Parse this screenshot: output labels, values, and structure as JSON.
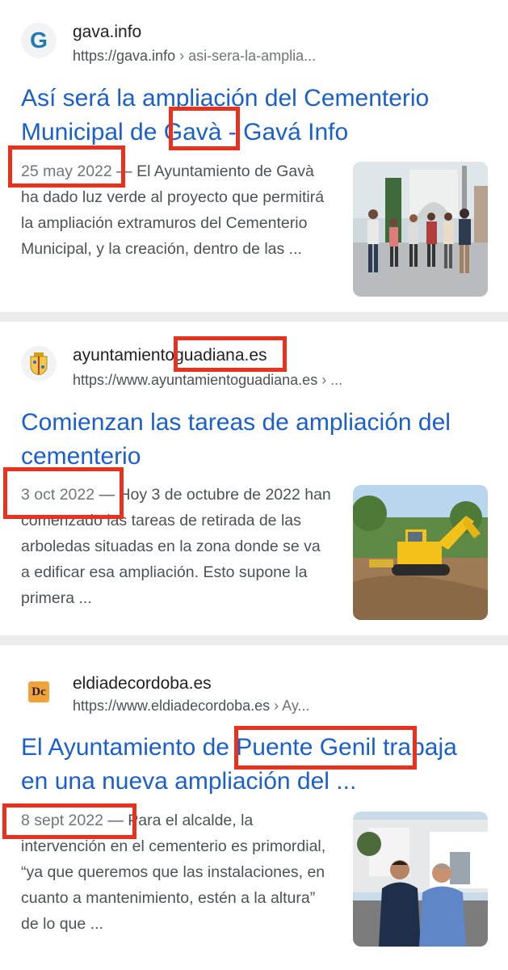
{
  "results": [
    {
      "site_name": "gava.info",
      "url_base": "https://gava.info",
      "url_path": " › asi-sera-la-amplia...",
      "favicon_icon": "gava-g-logo-icon",
      "favicon_letter": "G",
      "title_line1": "Así será la ampliación del Cementerio",
      "title_line2": "Municipal de Gavà - Gavá Info",
      "date": "25 may 2022",
      "snippet": " — El Ayuntamiento de Gavà ha dado luz verde al proyecto que permitirá la ampliación extramuros del Cementerio Municipal, y la creación, dentro de las ...",
      "thumbnail_icon": "cemetery-people-walking-photo"
    },
    {
      "site_name": "ayuntamientoguadiana.es",
      "url_base": "https://www.ayuntamientoguadiana.es",
      "url_path": " › ...",
      "favicon_icon": "coat-of-arms-shield-icon",
      "title_line1": "Comienzan las tareas de ampliación del",
      "title_line2": "cementerio",
      "date": "3 oct 2022",
      "snippet": " — Hoy 3 de octubre de 2022 han comenzado las tareas de retirada de las arboledas situadas en la zona donde se va a edificar esa ampliación. Esto supone la primera ...",
      "thumbnail_icon": "excavator-photo"
    },
    {
      "site_name": "eldiadecordoba.es",
      "url_base": "https://www.eldiadecordoba.es",
      "url_path": " › Ay...",
      "favicon_icon": "dc-logo-icon",
      "favicon_letter": "Dc",
      "title_line1": "El Ayuntamiento de Puente Genil trabaja",
      "title_line2": "en una nueva ampliación del ...",
      "date": "8 sept 2022",
      "snippet": " — Para el alcalde, la intervención en el cementerio es primordial, “ya que queremos que las instalaciones, en cuanto a mantenimiento, estén a la altura” de lo que ...",
      "thumbnail_icon": "two-men-portrait-photo"
    }
  ],
  "colors": {
    "title_link": "#1a5fce",
    "highlight_box": "#e8321e",
    "snippet_text": "#4d5156",
    "divider": "#ececec"
  }
}
